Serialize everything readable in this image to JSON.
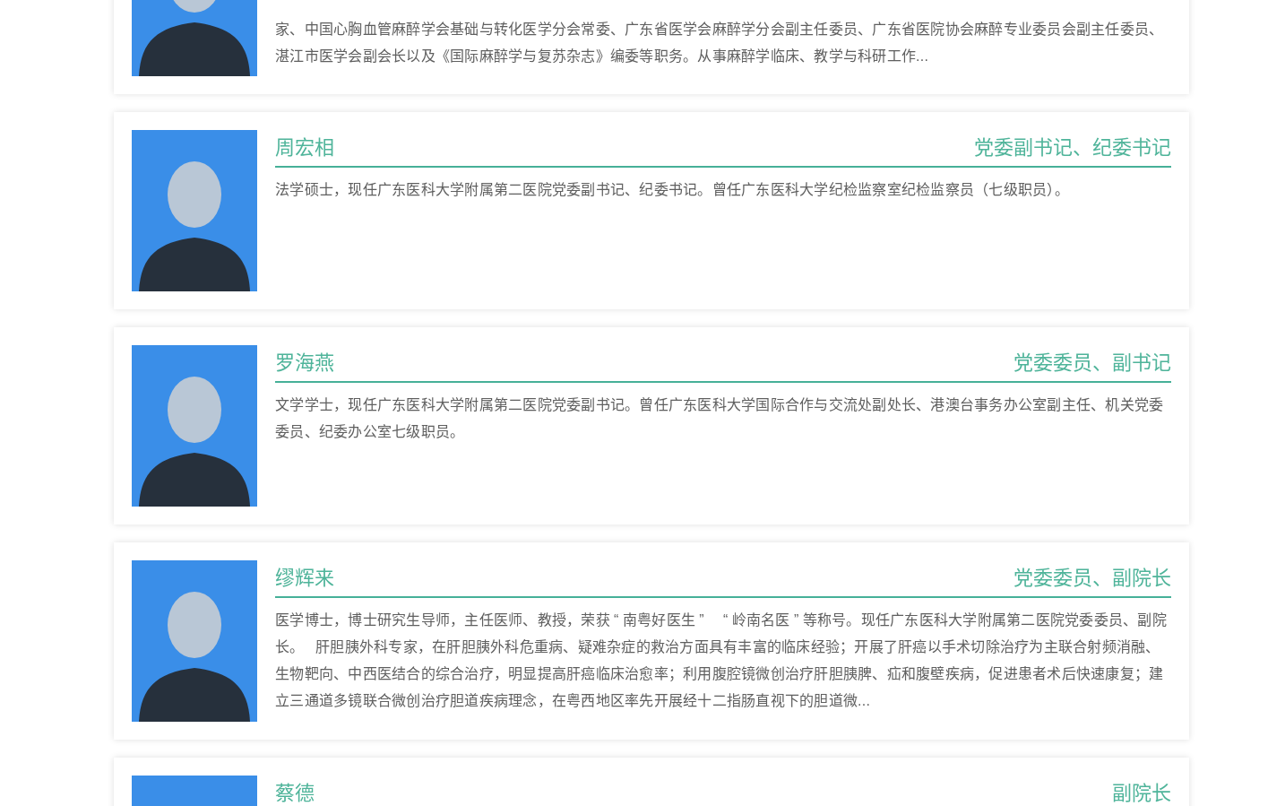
{
  "people": [
    {
      "description": "家、中国心胸血管麻醉学会基础与转化医学分会常委、广东省医学会麻醉学分会副主任委员、广东省医院协会麻醉专业委员会副主任委员、湛江市医学会副会长以及《国际麻醉学与复苏杂志》编委等职务。从事麻醉学临床、教学与科研工作..."
    },
    {
      "name": "周宏相",
      "title": "党委副书记、纪委书记",
      "description": "法学硕士，现任广东医科大学附属第二医院党委副书记、纪委书记。曾任广东医科大学纪检监察室纪检监察员（七级职员）。"
    },
    {
      "name": "罗海燕",
      "title": "党委委员、副书记",
      "description": "文学学士，现任广东医科大学附属第二医院党委副书记。曾任广东医科大学国际合作与交流处副处长、港澳台事务办公室副主任、机关党委委员、纪委办公室七级职员。"
    },
    {
      "name": "缪辉来",
      "title": "党委委员、副院长",
      "description": "医学博士，博士研究生导师，主任医师、教授，荣获“南粤好医生” “岭南名医”等称号。现任广东医科大学附属第二医院党委委员、副院长。 肝胆胰外科专家，在肝胆胰外科危重病、疑难杂症的救治方面具有丰富的临床经验；开展了肝癌以手术切除治疗为主联合射频消融、生物靶向、中西医结合的综合治疗，明显提高肝癌临床治愈率；利用腹腔镜微创治疗肝胆胰脾、疝和腹壁疾病，促进患者术后快速康复；建立三通道多镜联合微创治疗胆道疾病理念，在粤西地区率先开展经十二指肠直视下的胆道微..."
    },
    {
      "name": "蔡德",
      "title": "副院长"
    }
  ]
}
